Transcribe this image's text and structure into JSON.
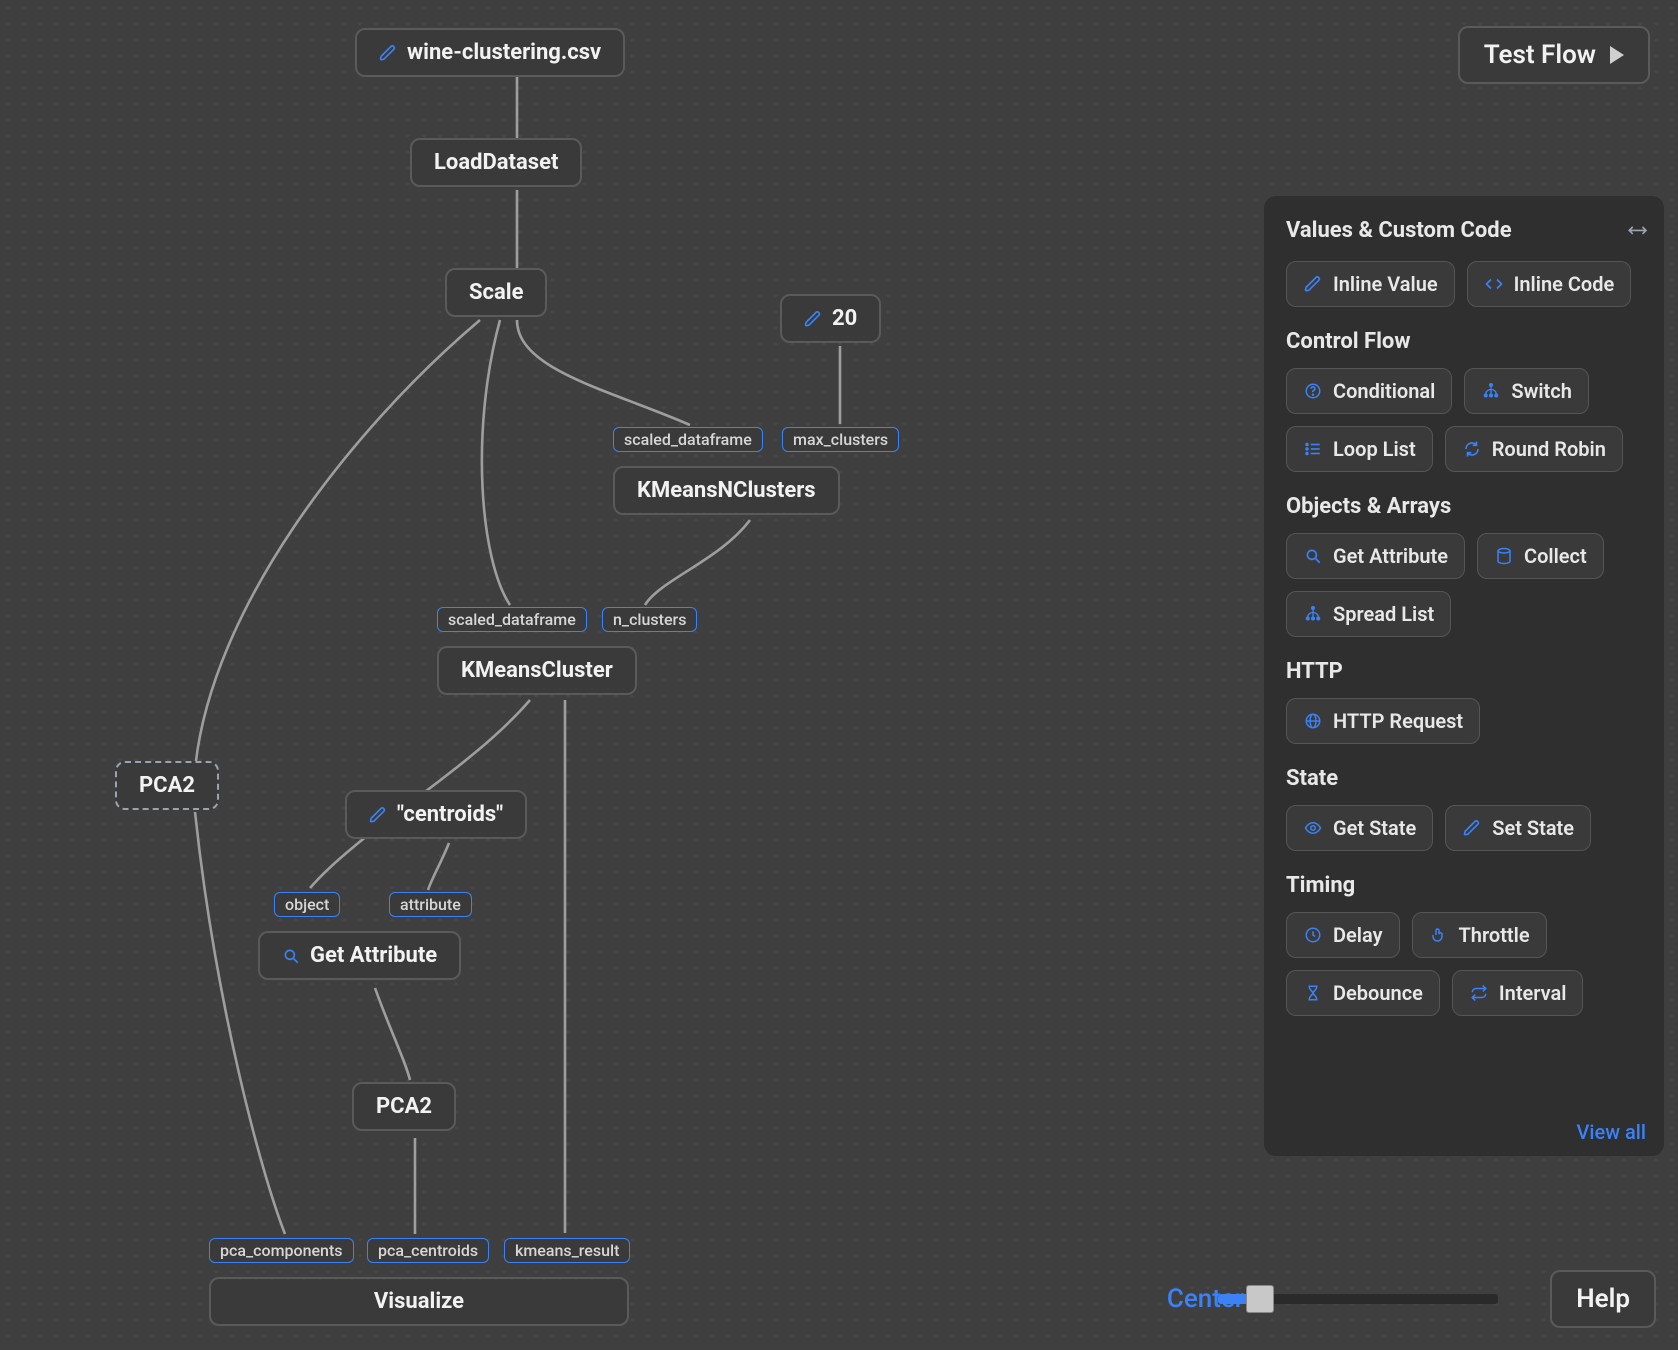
{
  "toolbar": {
    "test_flow_label": "Test Flow"
  },
  "nodes": {
    "wine_csv": {
      "label": "wine-clustering.csv"
    },
    "load_dataset": {
      "label": "LoadDataset"
    },
    "scale": {
      "label": "Scale"
    },
    "twenty": {
      "label": "20"
    },
    "kmeans_n": {
      "label": "KMeansNClusters",
      "params": {
        "scaled_df": "scaled_dataframe",
        "max_clusters": "max_clusters"
      }
    },
    "kmeans_cluster": {
      "label": "KMeansCluster",
      "params": {
        "scaled_df": "scaled_dataframe",
        "n_clusters": "n_clusters"
      }
    },
    "pca2_dashed": {
      "label": "PCA2"
    },
    "centroids_literal": {
      "label": "\"centroids\""
    },
    "get_attribute": {
      "label": "Get Attribute",
      "params": {
        "object": "object",
        "attribute": "attribute"
      }
    },
    "pca2": {
      "label": "PCA2"
    },
    "visualize": {
      "label": "Visualize",
      "params": {
        "pca_components": "pca_components",
        "pca_centroids": "pca_centroids",
        "kmeans_result": "kmeans_result"
      }
    }
  },
  "panel": {
    "title": "Values & Custom Code",
    "view_all_label": "View all",
    "sections": {
      "values": {
        "inline_value": "Inline Value",
        "inline_code": "Inline Code"
      },
      "control_flow_title": "Control Flow",
      "control_flow": {
        "conditional": "Conditional",
        "switch": "Switch",
        "loop_list": "Loop List",
        "round_robin": "Round Robin"
      },
      "objects_title": "Objects & Arrays",
      "objects": {
        "get_attribute": "Get Attribute",
        "collect": "Collect",
        "spread_list": "Spread List"
      },
      "http_title": "HTTP",
      "http": {
        "http_request": "HTTP Request"
      },
      "state_title": "State",
      "state": {
        "get_state": "Get State",
        "set_state": "Set State"
      },
      "timing_title": "Timing",
      "timing": {
        "delay": "Delay",
        "throttle": "Throttle",
        "debounce": "Debounce",
        "interval": "Interval"
      }
    }
  },
  "footer": {
    "center_label": "Center",
    "help_label": "Help",
    "zoom_percent": 14
  },
  "colors": {
    "accent": "#3b82f6",
    "panel_bg": "#2f2f2f",
    "canvas_bg": "#3f3f3f"
  }
}
